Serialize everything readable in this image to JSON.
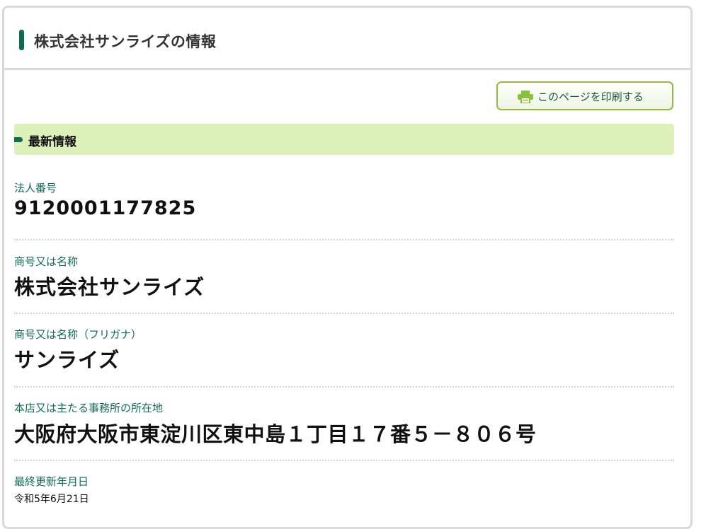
{
  "header": {
    "title": "株式会社サンライズの情報"
  },
  "toolbar": {
    "print_label": "このページを印刷する",
    "print_icon": "printer-icon"
  },
  "section": {
    "title": "最新情報"
  },
  "fields": [
    {
      "label": "法人番号",
      "value": "9120001177825"
    },
    {
      "label": "商号又は名称",
      "value": "株式会社サンライズ"
    },
    {
      "label": "商号又は名称（フリガナ）",
      "value": "サンライズ"
    },
    {
      "label": "本店又は主たる事務所の所在地",
      "value": "大阪府大阪市東淀川区東中島１丁目１７番５－８０６号"
    },
    {
      "label": "最終更新年月日",
      "value": "令和5年6月21日"
    }
  ],
  "colors": {
    "accent": "#0f6b55",
    "section_bg": "#ddf0b9",
    "button_border": "#8dbf3e"
  }
}
